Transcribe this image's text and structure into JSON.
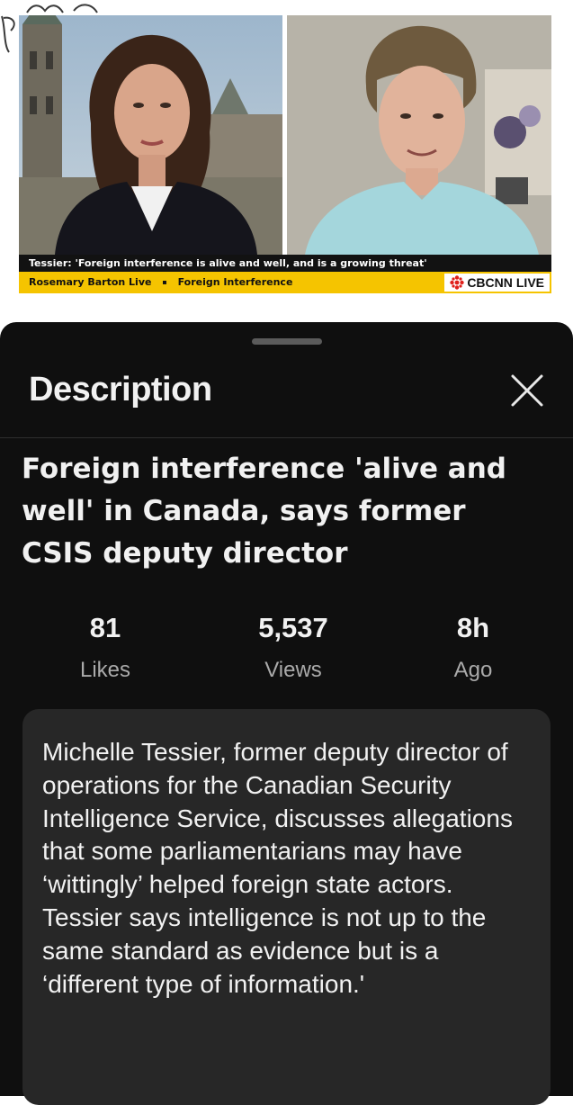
{
  "video": {
    "headline": "Tessier: 'Foreign interference is alive and well, and is a growing threat'",
    "show_name": "Rosemary Barton Live",
    "separator": "▪",
    "topic": "Foreign Interference",
    "network": "CBCNN",
    "live_label": "LIVE",
    "accent_color": "#f5c400"
  },
  "sheet": {
    "title": "Description",
    "close_icon": "close-icon",
    "video_title": "Foreign interference 'alive and well' in Canada, says former CSIS deputy director",
    "stats": [
      {
        "value": "81",
        "label": "Likes"
      },
      {
        "value": "5,537",
        "label": "Views"
      },
      {
        "value": "8h",
        "label": "Ago"
      }
    ],
    "description": "Michelle Tessier, former deputy director of operations for the Canadian Security Intelligence Service, discusses allegations that some parliamentarians may have ‘wittingly’ helped foreign state actors. Tessier says intelligence is not up to the same standard as evidence but is a ‘different type of information.'"
  }
}
